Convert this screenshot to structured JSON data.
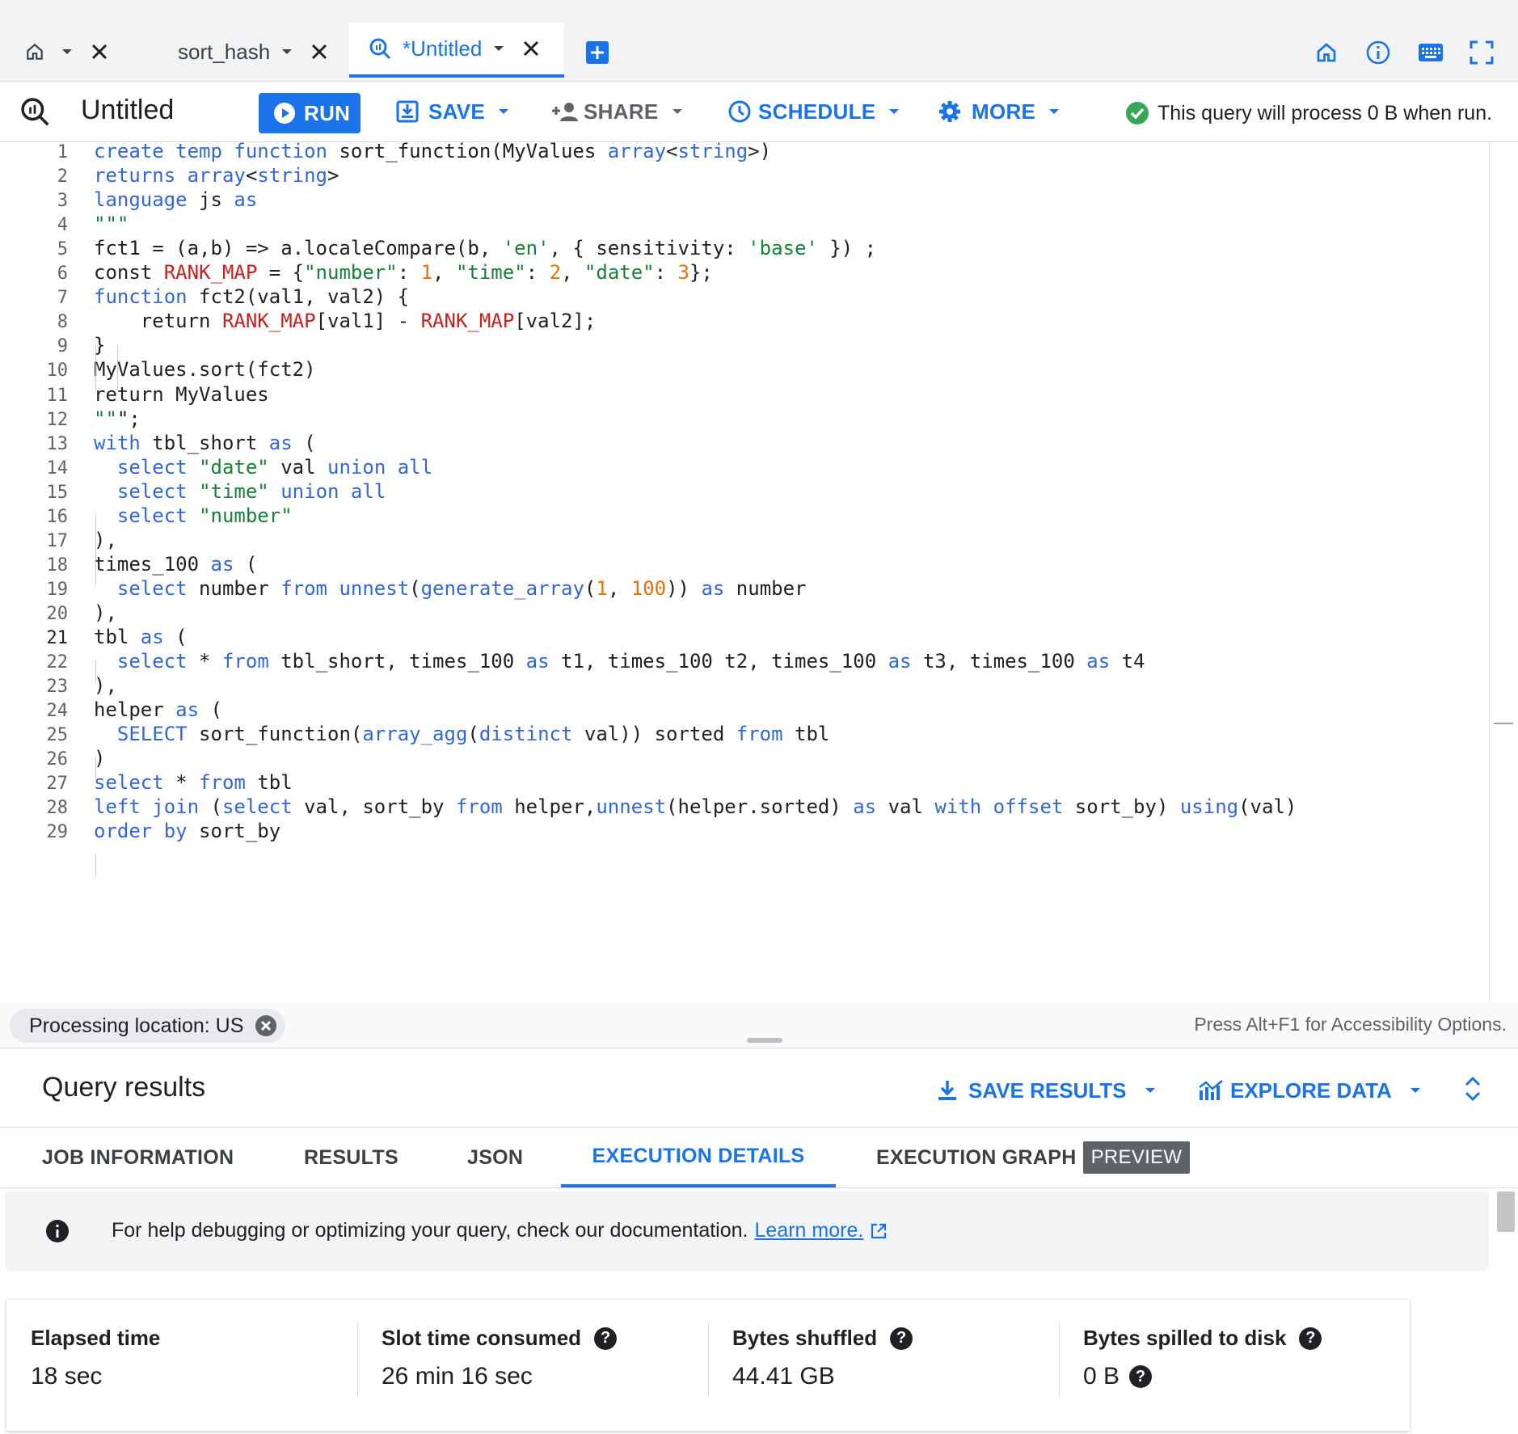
{
  "tabs": {
    "items": [
      {
        "label": "sort_hash"
      },
      {
        "label": "*Untitled"
      }
    ]
  },
  "toolbar": {
    "title": "Untitled",
    "run_label": "RUN",
    "save_label": "SAVE",
    "share_label": "SHARE",
    "schedule_label": "SCHEDULE",
    "more_label": "MORE",
    "validation_text": "This query will process 0 B when run."
  },
  "editor": {
    "line_numbers": [
      "1",
      "2",
      "3",
      "4",
      "5",
      "6",
      "7",
      "8",
      "9",
      "10",
      "11",
      "12",
      "13",
      "14",
      "15",
      "16",
      "17",
      "18",
      "19",
      "20",
      "21",
      "22",
      "23",
      "24",
      "25",
      "26",
      "27",
      "28",
      "29"
    ],
    "lines": [
      "create temp function sort_function(MyValues array<string>)",
      "returns array<string>",
      "language js as",
      "\"\"\"",
      "fct1 = (a,b) => a.localeCompare(b, 'en', { sensitivity: 'base' }) ;",
      "const RANK_MAP = {\"number\": 1, \"time\": 2, \"date\": 3};",
      "function fct2(val1, val2) {",
      "    return RANK_MAP[val1] - RANK_MAP[val2];",
      "}",
      "MyValues.sort(fct2)",
      "return MyValues",
      "\"\"\";",
      "with tbl_short as (",
      "  select \"date\" val union all",
      "  select \"time\" union all",
      "  select \"number\"",
      "),",
      "times_100 as (",
      "  select number from unnest(generate_array(1, 100)) as number",
      "),",
      "tbl as (",
      "  select * from tbl_short, times_100 as t1, times_100 t2, times_100 as t3, times_100 as t4",
      "),",
      "helper as (",
      "  SELECT sort_function(array_agg(distinct val)) sorted from tbl",
      ")",
      "select * from tbl",
      "left join (select val, sort_by from helper,unnest(helper.sorted) as val with offset sort_by) using(val)",
      "order by sort_by"
    ]
  },
  "status": {
    "location_chip": "Processing location: US",
    "accessibility_hint": "Press Alt+F1 for Accessibility Options."
  },
  "results": {
    "title": "Query results",
    "save_results_label": "SAVE RESULTS",
    "explore_data_label": "EXPLORE DATA",
    "tabs": [
      {
        "label": "JOB INFORMATION"
      },
      {
        "label": "RESULTS"
      },
      {
        "label": "JSON"
      },
      {
        "label": "EXECUTION DETAILS"
      },
      {
        "label": "EXECUTION GRAPH"
      }
    ],
    "preview_badge": "PREVIEW",
    "info_text": "For help debugging or optimizing your query, check our documentation.",
    "learn_more": "Learn more.",
    "metrics": [
      {
        "label": "Elapsed time",
        "value": "18 sec"
      },
      {
        "label": "Slot time consumed",
        "value": "26 min 16 sec"
      },
      {
        "label": "Bytes shuffled",
        "value": "44.41 GB"
      },
      {
        "label": "Bytes spilled to disk",
        "value": "0 B"
      }
    ]
  },
  "colors": {
    "accent": "#1a73e8",
    "keyword": "#3367d6",
    "string": "#188038",
    "number": "#e8710a",
    "success": "#34a853"
  }
}
